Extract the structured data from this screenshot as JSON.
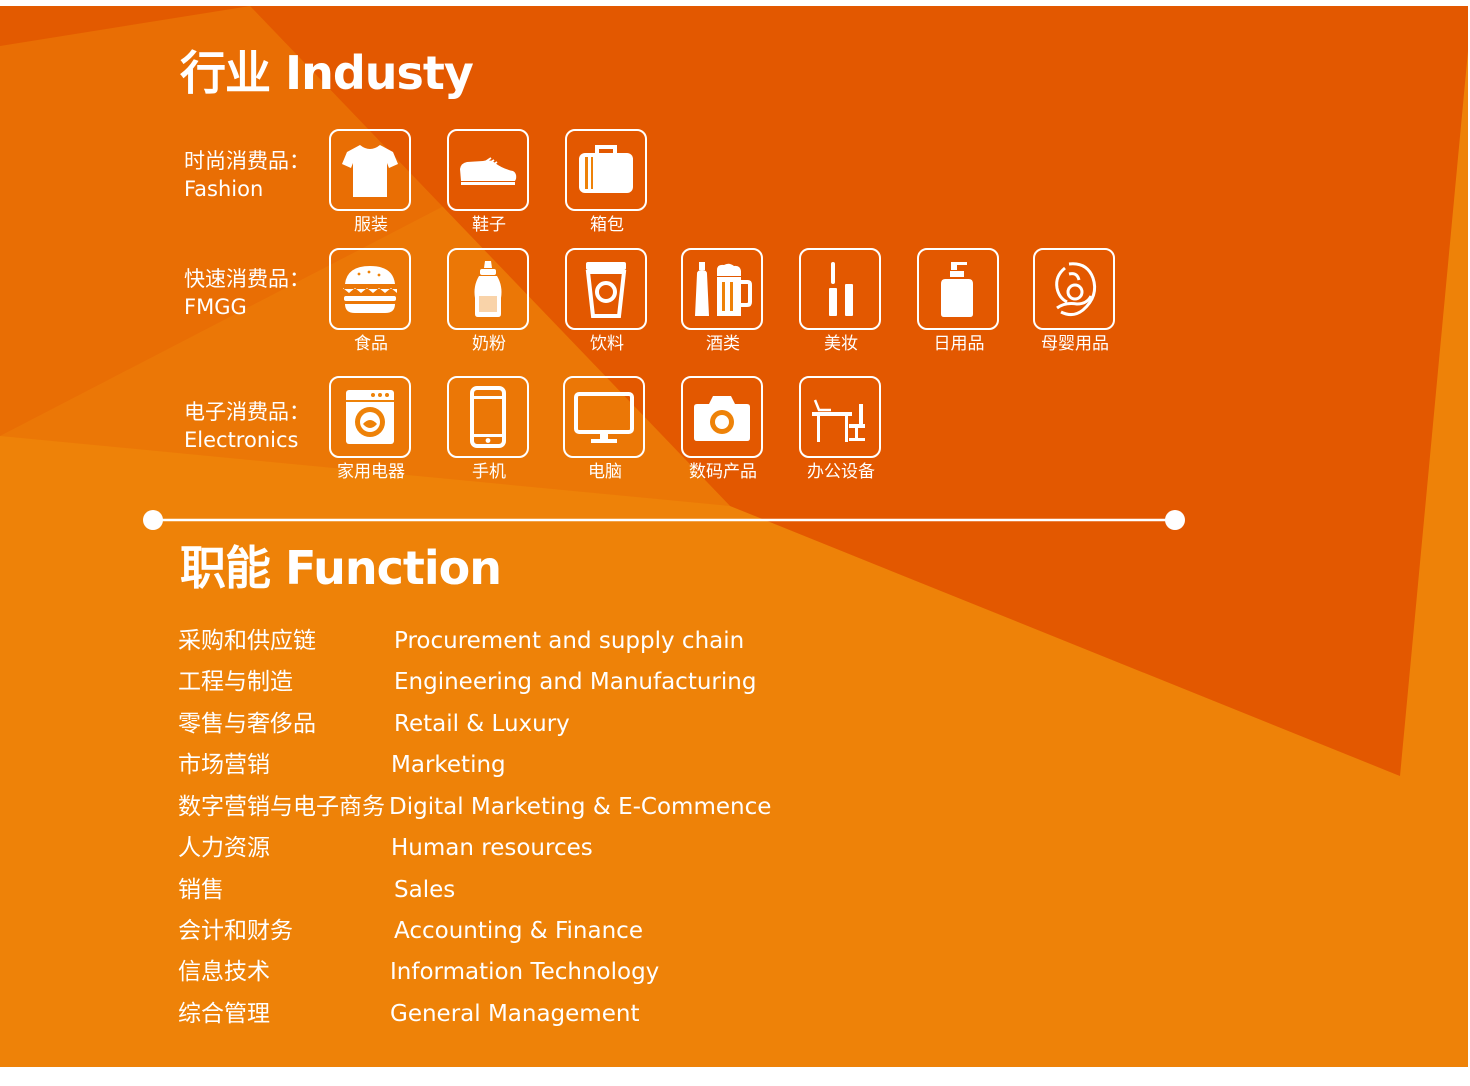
{
  "industry": {
    "heading": "行业 Industy",
    "categories": [
      {
        "label_zh": "时尚消费品：",
        "label_en": "Fashion",
        "items": [
          {
            "label": "服装",
            "icon": "tshirt-icon"
          },
          {
            "label": "鞋子",
            "icon": "shoe-icon"
          },
          {
            "label": "箱包",
            "icon": "briefcase-icon"
          }
        ]
      },
      {
        "label_zh": "快速消费品：",
        "label_en": "FMGG",
        "items": [
          {
            "label": "食品",
            "icon": "burger-icon"
          },
          {
            "label": "奶粉",
            "icon": "baby-bottle-icon"
          },
          {
            "label": "饮料",
            "icon": "drink-cup-icon"
          },
          {
            "label": "酒类",
            "icon": "beer-icon"
          },
          {
            "label": "美妆",
            "icon": "mascara-icon"
          },
          {
            "label": "日用品",
            "icon": "lotion-bottle-icon"
          },
          {
            "label": "母婴用品",
            "icon": "mother-baby-icon"
          }
        ]
      },
      {
        "label_zh": "电子消费品：",
        "label_en": "Electronics",
        "items": [
          {
            "label": "家用电器",
            "icon": "washing-machine-icon"
          },
          {
            "label": "手机",
            "icon": "mobile-phone-icon"
          },
          {
            "label": "电脑",
            "icon": "monitor-icon"
          },
          {
            "label": "数码产品",
            "icon": "camera-icon"
          },
          {
            "label": "办公设备",
            "icon": "office-desk-icon"
          }
        ]
      }
    ]
  },
  "function": {
    "heading": "职能 Function",
    "rows": [
      {
        "zh": "采购和供应链",
        "en": "Procurement and supply chain"
      },
      {
        "zh": "工程与制造",
        "en": "Engineering and Manufacturing"
      },
      {
        "zh": "零售与奢侈品",
        "en": "Retail & Luxury"
      },
      {
        "zh": "市场营销",
        "en": "Marketing"
      },
      {
        "zh": "数字营销与电子商务",
        "en": "Digital Marketing & E-Commence"
      },
      {
        "zh": "人力资源",
        "en": "Human resources"
      },
      {
        "zh": "销售",
        "en": "Sales"
      },
      {
        "zh": "会计和财务",
        "en": "Accounting & Finance"
      },
      {
        "zh": "信息技术",
        "en": "Information Technology"
      },
      {
        "zh": "综合管理",
        "en": "General Management"
      }
    ]
  },
  "colors": {
    "background_orange": "#ee8208",
    "dark_orange": "#e35a00",
    "mid_orange": "#e96d04",
    "foreground": "#ffffff"
  }
}
